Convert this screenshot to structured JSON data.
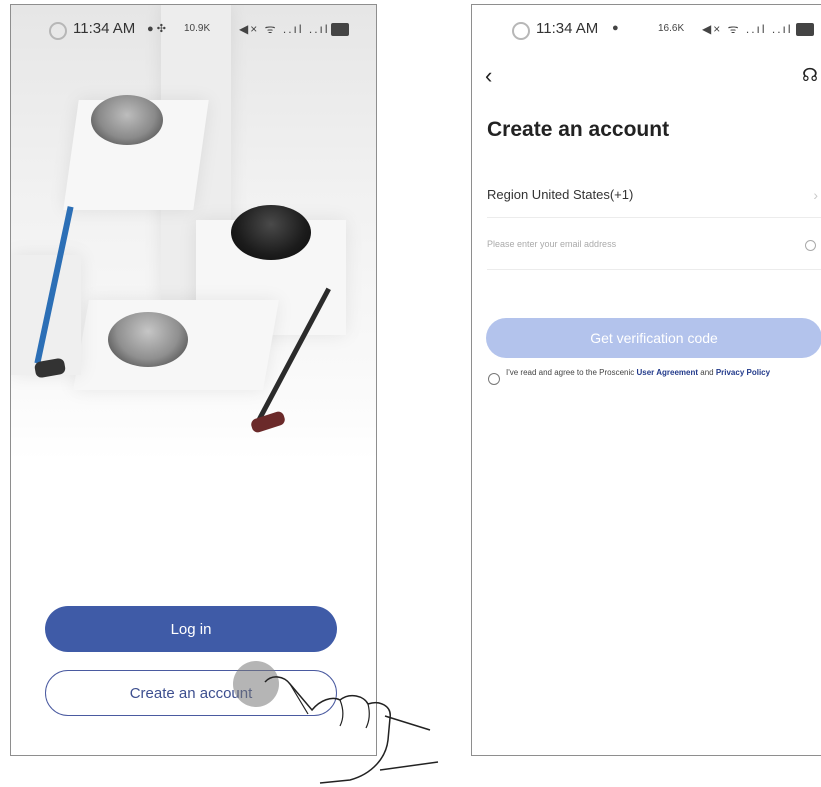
{
  "left_screen": {
    "status": {
      "time": "11:34 AM",
      "netspeed": "10.9K"
    },
    "login_label": "Log in",
    "create_label": "Create an account"
  },
  "right_screen": {
    "status": {
      "time": "11:34 AM",
      "netspeed": "16.6K"
    },
    "title": "Create an account",
    "region": "Region United States(+1)",
    "email_placeholder": "Please enter your email address",
    "verify_label": "Get verification code",
    "agreement": {
      "prefix": "I've read and agree to the Proscenic ",
      "user_agreement": "User Agreement",
      "and": " and ",
      "privacy": "Privacy Policy"
    }
  },
  "colors": {
    "primary": "#3f5ba7",
    "disabled": "#b3c3ec",
    "link": "#223a8b"
  },
  "icons": [
    "back-icon",
    "headset-icon",
    "chevron-right-icon",
    "clear-icon",
    "wifi-icon",
    "signal-icon",
    "battery-icon",
    "mute-icon"
  ]
}
